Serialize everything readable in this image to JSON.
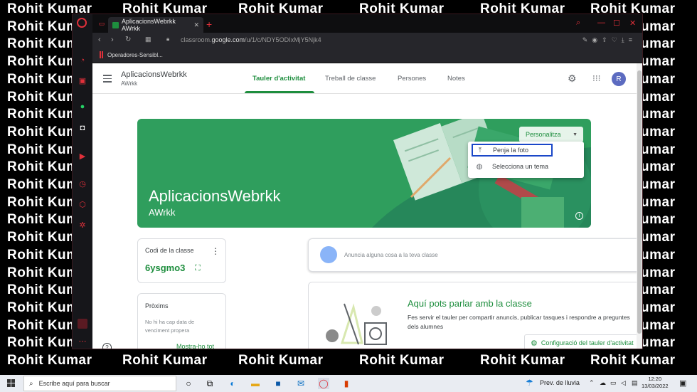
{
  "watermark": {
    "text": "Rohit Kumar"
  },
  "browser": {
    "tab_title": "AplicacionsWebrkk AWrkk",
    "url_prefix": "classroom.",
    "url_domain": "google.com",
    "url_path": "/u/1/c/NDY5ODIxMjY5Njk4",
    "bookmark": "Operadores-Sensibl..."
  },
  "classroom": {
    "class_name": "AplicacionsWebrkk",
    "section": "AWrkk",
    "tabs": [
      "Tauler d'activitat",
      "Treball de classe",
      "Persones",
      "Notes"
    ],
    "active_tab": 0,
    "avatar_letter": "R",
    "banner": {
      "title": "AplicacionsWebrkk",
      "subtitle": "AWrkk",
      "customize_label": "Personalitza",
      "menu": [
        "Penja la foto",
        "Selecciona un tema"
      ]
    },
    "code_card": {
      "label": "Codi de la classe",
      "code": "6ysgmo3"
    },
    "upcoming": {
      "label": "Pròxims",
      "text": "No hi ha cap data de venciment propera",
      "link": "Mostra-ho tot"
    },
    "announce_placeholder": "Anuncia alguna cosa a la teva classe",
    "talk": {
      "title": "Aquí pots parlar amb la classe",
      "text": "Fes servir el tauler per compartir anuncis, publicar tasques i respondre a preguntes dels alumnes",
      "button": "Configuració del tauler d'activitat"
    }
  },
  "taskbar": {
    "search_placeholder": "Escribe aquí para buscar",
    "weather": "Prev. de lluvia",
    "time": "12:20",
    "date": "13/03/2022"
  },
  "colors": {
    "accent": "#1e8e3e",
    "banner": "#2f9e5d",
    "opera_red": "#e0303a",
    "highlight": "#1a47c8"
  }
}
